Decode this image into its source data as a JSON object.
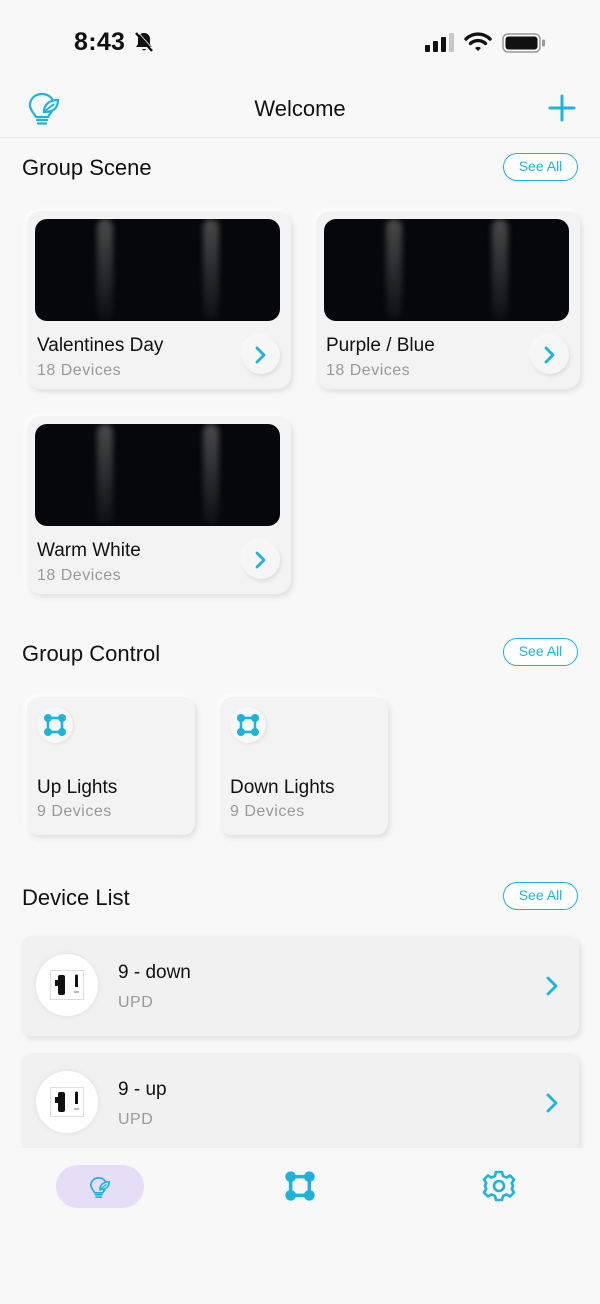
{
  "status_bar": {
    "time": "8:43"
  },
  "header": {
    "title": "Welcome"
  },
  "colors": {
    "accent": "#1eb4d9",
    "tab_active_bg": "#e6def6"
  },
  "group_scene": {
    "title": "Group Scene",
    "see_all": "See All",
    "scenes": [
      {
        "name": "Valentines Day",
        "count": "18 Devices"
      },
      {
        "name": "Purple / Blue",
        "count": "18 Devices"
      },
      {
        "name": "Warm White",
        "count": "18 Devices"
      }
    ]
  },
  "group_control": {
    "title": "Group Control",
    "see_all": "See All",
    "groups": [
      {
        "name": "Up Lights",
        "count": "9 Devices"
      },
      {
        "name": "Down Lights",
        "count": "9 Devices"
      }
    ]
  },
  "device_list": {
    "title": "Device List",
    "see_all": "See All",
    "devices": [
      {
        "name": "9 - down",
        "type": "UPD"
      },
      {
        "name": "9 - up",
        "type": "UPD"
      }
    ]
  },
  "tabs": [
    {
      "icon": "bulb-leaf-icon",
      "active": true
    },
    {
      "icon": "group-nodes-icon",
      "active": false
    },
    {
      "icon": "gear-icon",
      "active": false
    }
  ]
}
